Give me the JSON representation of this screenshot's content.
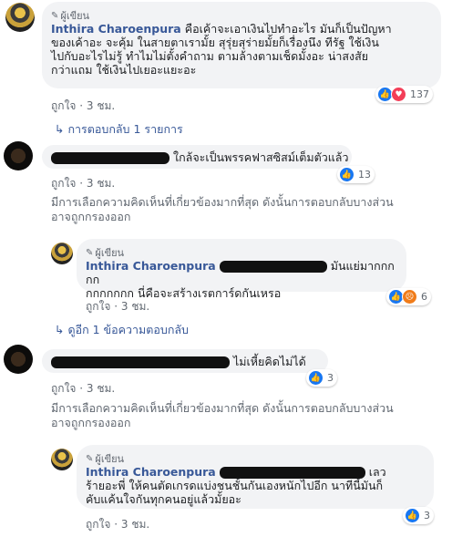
{
  "comments": [
    {
      "author_badge": "ผู้เขียน",
      "author": "Inthira Charoenpura",
      "lines": [
        "คือเค้าจะเอาเงินไปทำอะไร มันก็เป็นปัญหา",
        "ของเค้าอะ จะคุ้ม ในสายตาเรามั้ย สุรุ่ยสุร่ายมั้ยก็เรื่องนึง ทีรัฐ ใช้เงิน",
        "ไปกับอะไรไม่รู้ ทำไมไม่ตั้งคำถาม ตามล้างตามเช็ดมั้งอะ น่าสงสัย",
        "กว่าแถม ใช้เงินไปเยอะแยะอะ"
      ],
      "reaction_count": "137",
      "like_label": "ถูกใจ",
      "time": "3 ชม."
    },
    {
      "text": "ใกล้จะเป็นพรรคฟาสซิสม์เต็มตัวแล้ว",
      "reaction_count": "13",
      "like_label": "ถูกใจ",
      "time": "3 ชม."
    },
    {
      "text": "ไม่เหี้ยคิดไม่ได้",
      "reaction_count": "3",
      "like_label": "ถูกใจ",
      "time": "3 ชม."
    }
  ],
  "replies_link": "การตอบกลับ 1 รายการ",
  "more_replies_link": "ดูอีก 1 ข้อความตอบกลับ",
  "filtered_note_line1": "มีการเลือกความคิดเห็นที่เกี่ยวข้องมากที่สุด ดังนั้นการตอบกลับบางส่วน",
  "filtered_note_line2": "อาจถูกกรองออก",
  "replies": [
    {
      "author_badge": "ผู้เขียน",
      "author": "Inthira Charoenpura",
      "line1_tail": "มันแย่มากกกกก",
      "line2": "กกกกกกก นี่คือจะสร้างเรตการ์ดกันเหรอ",
      "reaction_count": "6",
      "like_label": "ถูกใจ",
      "time": "3 ชม."
    },
    {
      "author_badge": "ผู้เขียน",
      "author": "Inthira Charoenpura",
      "line1_tail": "เลว",
      "line2": "ร้ายอะพี่ ให้คนตัดเกรดแบ่งชนชั้นกันเองหนักไปอีก นาทีนี้มันก็",
      "line3": "คับแค้นใจกันทุกคนอยู่แล้วมั้ยอะ",
      "reaction_count": "3",
      "like_label": "ถูกใจ",
      "time": "3 ชม."
    }
  ]
}
